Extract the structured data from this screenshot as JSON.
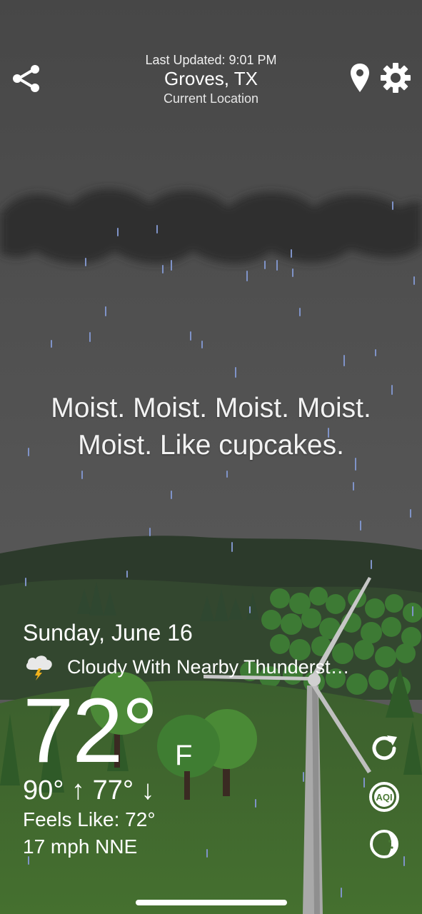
{
  "header": {
    "last_updated": "Last Updated: 9:01 PM",
    "city": "Groves, TX",
    "location_label": "Current Location"
  },
  "icons": {
    "share": "share-icon",
    "location": "location-pin-icon",
    "settings": "gear-icon",
    "condition": "thunderstorm-cloud-icon",
    "refresh": "refresh-icon",
    "aqi": "aqi-icon",
    "moon": "moon-phase-icon"
  },
  "aqi_label": "AQI",
  "quote": {
    "line1": "Moist. Moist. Moist. Moist.",
    "line2": "Moist. Like cupcakes."
  },
  "weather": {
    "date": "Sunday, June 16",
    "condition": "Cloudy With Nearby Thunderst…",
    "temperature": "72°",
    "unit": "F",
    "hilo": "90° ↑  77° ↓",
    "feels_like": "Feels Like: 72°",
    "wind": "17 mph NNE"
  },
  "colors": {
    "sky_top": "#444444",
    "sky_bottom": "#5c5c5c",
    "cloud": "#2b2b2b",
    "rain": "#7f93c8",
    "hills_dark": "#2d3a2b",
    "grass": "#3f6a2c",
    "trees": "#3e7430"
  }
}
